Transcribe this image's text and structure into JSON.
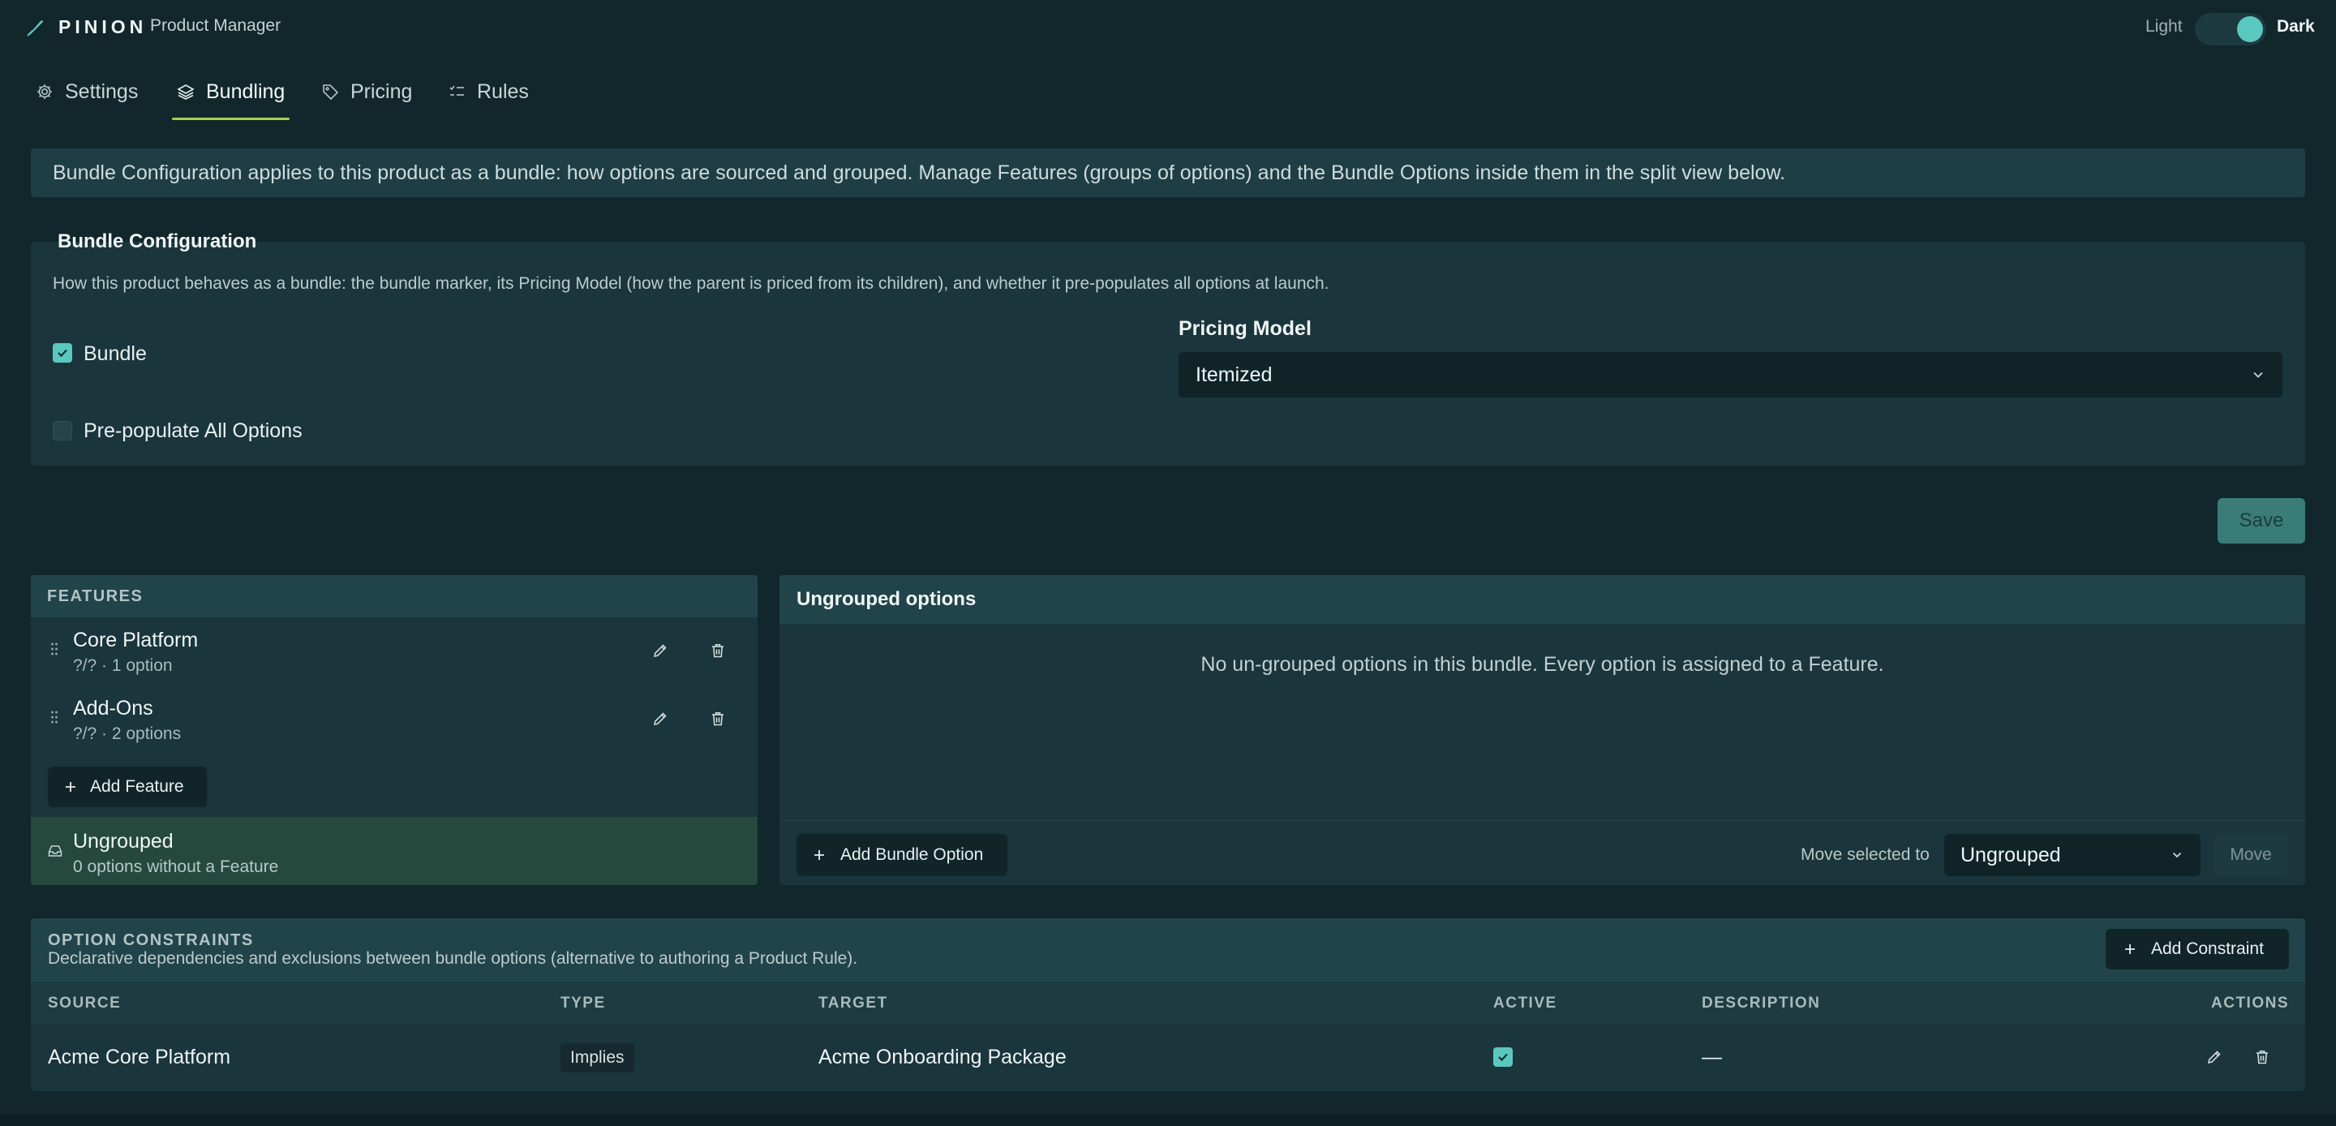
{
  "app": {
    "brand": "PINION",
    "subtitle": "Product Manager",
    "theme": {
      "light_label": "Light",
      "dark_label": "Dark",
      "current": "Dark"
    }
  },
  "tabs": [
    {
      "label": "Settings",
      "icon": "gear-icon"
    },
    {
      "label": "Bundling",
      "icon": "layers-icon",
      "active": true
    },
    {
      "label": "Pricing",
      "icon": "tag-icon"
    },
    {
      "label": "Rules",
      "icon": "checklist-icon"
    }
  ],
  "info_banner": "Bundle Configuration applies to this product as a bundle: how options are sourced and grouped. Manage Features (groups of options) and the Bundle Options inside them in the split view below.",
  "bundle_config": {
    "title": "Bundle Configuration",
    "description": "How this product behaves as a bundle: the bundle marker, its Pricing Model (how the parent is priced from its children), and whether it pre-populates all options at launch.",
    "bundle": {
      "label": "Bundle",
      "checked": true
    },
    "prepopulate": {
      "label": "Pre-populate All Options",
      "checked": false
    },
    "pricing_model": {
      "label": "Pricing Model",
      "value": "Itemized"
    },
    "save_label": "Save"
  },
  "features": {
    "header": "FEATURES",
    "items": [
      {
        "name": "Core Platform",
        "meta": "?/? · 1 option"
      },
      {
        "name": "Add-Ons",
        "meta": "?/? · 2 options"
      }
    ],
    "add_label": "Add Feature",
    "ungrouped": {
      "name": "Ungrouped",
      "meta": "0 options without a Feature"
    }
  },
  "ungrouped_options": {
    "title": "Ungrouped options",
    "empty_message": "No un-grouped options in this bundle. Every option is assigned to a Feature.",
    "add_label": "Add Bundle Option",
    "move_label": "Move selected to",
    "move_target": "Ungrouped",
    "move_button": "Move"
  },
  "constraints": {
    "title": "OPTION CONSTRAINTS",
    "description": "Declarative dependencies and exclusions between bundle options (alternative to authoring a Product Rule).",
    "add_label": "Add Constraint",
    "columns": [
      "SOURCE",
      "TYPE",
      "TARGET",
      "ACTIVE",
      "DESCRIPTION",
      "ACTIONS"
    ],
    "rows": [
      {
        "source": "Acme Core Platform",
        "type": "Implies",
        "target": "Acme Onboarding Package",
        "active": true,
        "description": "—"
      }
    ]
  },
  "colors": {
    "background": "#11272c",
    "panel": "#1a353b",
    "accent": "#5bc8c0",
    "tab_underline": "#a6cf53",
    "save_button": "#3a7c78",
    "selected_row": "#25493d"
  }
}
